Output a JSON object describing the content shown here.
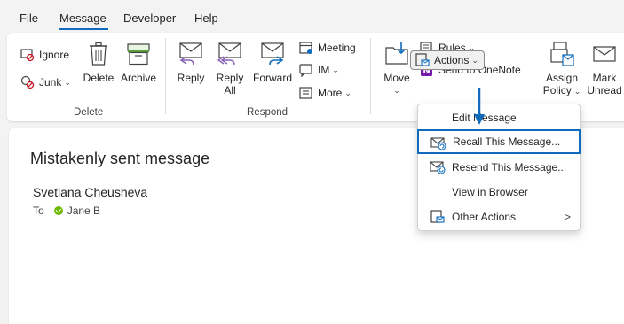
{
  "tabs": [
    "File",
    "Message",
    "Developer",
    "Help"
  ],
  "active_tab": "Message",
  "ribbon": {
    "delete_group": {
      "label": "Delete",
      "ignore": "Ignore",
      "junk": "Junk",
      "delete": "Delete",
      "archive": "Archive"
    },
    "respond_group": {
      "label": "Respond",
      "reply": "Reply",
      "reply_all_1": "Reply",
      "reply_all_2": "All",
      "forward": "Forward",
      "meeting": "Meeting",
      "im": "IM",
      "more": "More"
    },
    "move_group": {
      "move": "Move",
      "rules": "Rules",
      "send_to_onenote": "Send to OneNote",
      "actions": "Actions"
    },
    "tags_group": {
      "assign_policy_1": "Assign",
      "assign_policy_2": "Policy",
      "mark_unread_1": "Mark",
      "mark_unread_2": "Unread"
    }
  },
  "actions_menu": {
    "items": [
      {
        "label": "Edit Message",
        "icon": "none"
      },
      {
        "label": "Recall This Message...",
        "icon": "recall-envelope-icon",
        "highlighted": true
      },
      {
        "label": "Resend This Message...",
        "icon": "resend-envelope-icon"
      },
      {
        "label": "View in Browser",
        "icon": "none"
      },
      {
        "label": "Other Actions",
        "icon": "other-actions-icon",
        "submenu": true
      }
    ]
  },
  "message": {
    "subject": "Mistakenly sent message",
    "sender": "Svetlana Cheusheva",
    "to_label": "To",
    "recipient": "Jane B",
    "recipient_status_color": "#6bb700"
  },
  "colors": {
    "accent": "#0f6cbd",
    "onenote": "#7719aa"
  }
}
